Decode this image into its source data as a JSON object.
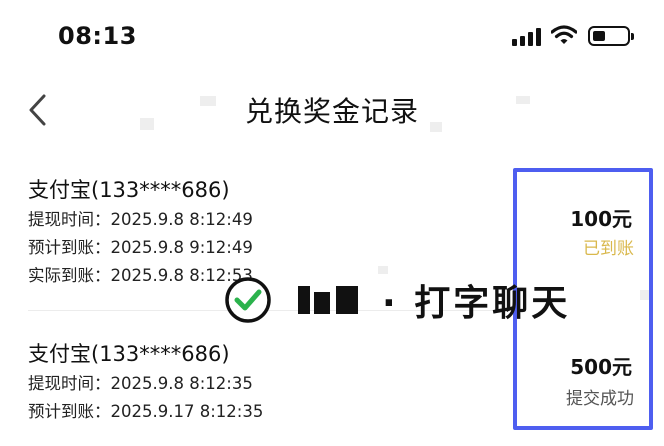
{
  "status_bar": {
    "time": "08:13"
  },
  "nav": {
    "title": "兑换奖金记录"
  },
  "records": [
    {
      "title": "支付宝(133****686)",
      "lines": [
        "提现时间：2025.9.8 8:12:49",
        "预计到账：2025.9.8 9:12:49",
        "实际到账：2025.9.8 8:12:53"
      ],
      "amount": "100元",
      "status": "已到账",
      "status_color": "#d9b84c"
    },
    {
      "title": "支付宝(133****686)",
      "lines": [
        "提现时间：2025.9.8 8:12:35",
        "预计到账：2025.9.17 8:12:35"
      ],
      "amount": "500元",
      "status": "提交成功",
      "status_color": "#555555"
    }
  ],
  "overlay": {
    "text": "· 打字聊天"
  },
  "colors": {
    "highlight_border": "#4e5ef0",
    "check_green": "#2bb24c"
  }
}
